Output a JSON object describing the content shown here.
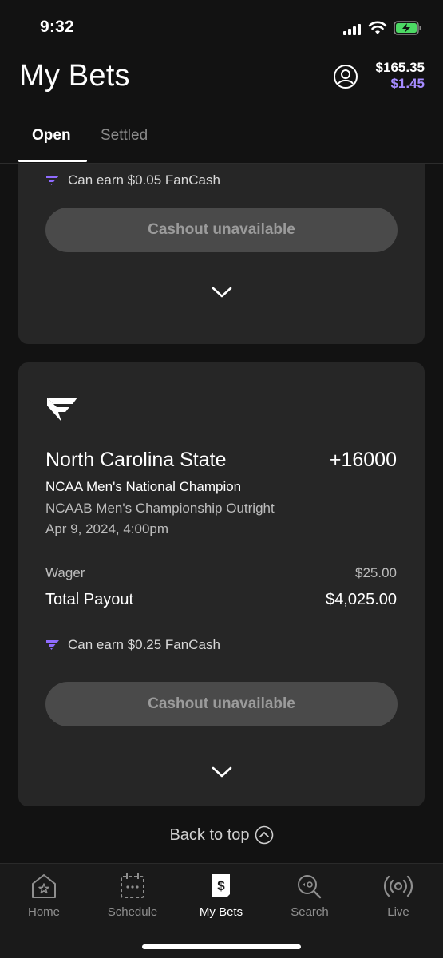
{
  "status_bar": {
    "time": "9:32",
    "icons": [
      "signal-icon",
      "wifi-icon",
      "battery-charging-icon"
    ]
  },
  "header": {
    "title": "My Bets",
    "balance_cash": "$165.35",
    "balance_fancash": "$1.45",
    "fancash_color": "#a58bff"
  },
  "tabs": [
    {
      "label": "Open",
      "selected": true
    },
    {
      "label": "Settled",
      "selected": false
    }
  ],
  "bets": [
    {
      "fancash_text": "Can earn $0.05 FanCash",
      "cashout_label": "Cashout unavailable"
    },
    {
      "selection": "North Carolina State",
      "odds": "+16000",
      "market": "NCAA Men's National Champion",
      "event": "NCAAB Men's Championship Outright",
      "date": "Apr 9, 2024, 4:00pm",
      "wager_label": "Wager",
      "wager_value": "$25.00",
      "payout_label": "Total Payout",
      "payout_value": "$4,025.00",
      "fancash_text": "Can earn $0.25 FanCash",
      "cashout_label": "Cashout unavailable"
    }
  ],
  "back_to_top": "Back to top",
  "nav": [
    {
      "label": "Home",
      "icon": "home-icon",
      "active": false
    },
    {
      "label": "Schedule",
      "icon": "calendar-icon",
      "active": false
    },
    {
      "label": "My Bets",
      "icon": "bet-slip-icon",
      "active": true
    },
    {
      "label": "Search",
      "icon": "search-icon",
      "active": false
    },
    {
      "label": "Live",
      "icon": "live-broadcast-icon",
      "active": false
    }
  ],
  "colors": {
    "background": "#121212",
    "card": "#262626",
    "button": "#4a4a4a",
    "accent_purple": "#a58bff"
  }
}
